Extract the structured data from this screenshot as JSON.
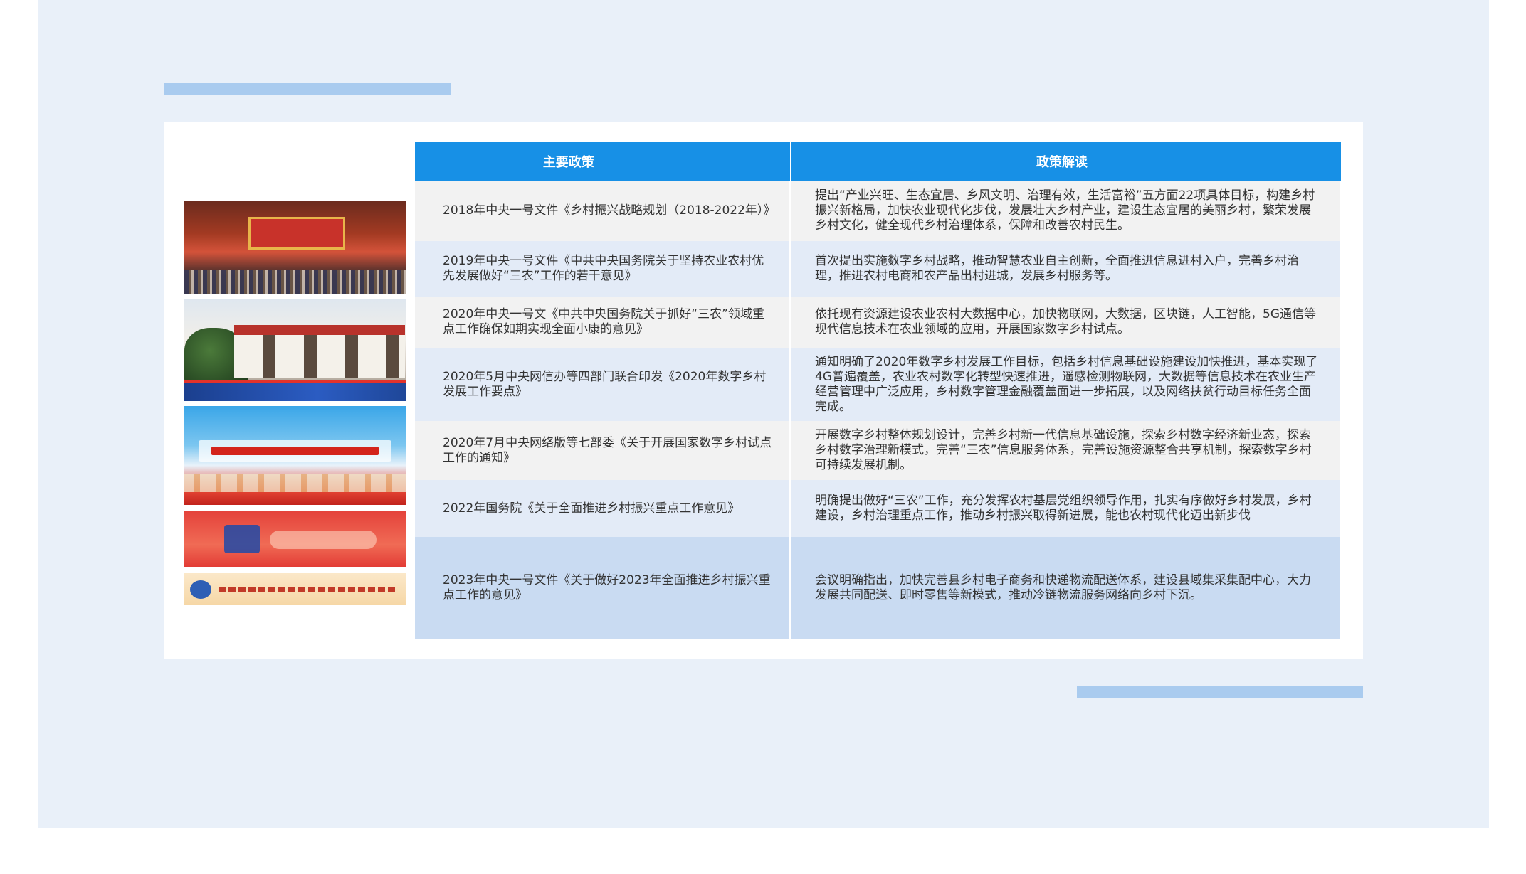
{
  "table": {
    "headers": [
      "主要政策",
      "政策解读"
    ],
    "rows": [
      {
        "policy": "2018年中央一号文件《乡村振兴战略规划（2018-2022年）》",
        "interpretation": "提出“产业兴旺、生态宜居、乡风文明、治理有效，生活富裕”五方面22项具体目标，构建乡村振兴新格局，加快农业现代化步伐，发展壮大乡村产业，建设生态宜居的美丽乡村，繁荣发展乡村文化，健全现代乡村治理体系，保障和改善农村民生。"
      },
      {
        "policy": "2019年中央一号文件《中共中央国务院关于坚持农业农村优先发展做好“三农”工作的若干意见》",
        "interpretation": "首次提出实施数字乡村战略，推动智慧农业自主创新，全面推进信息进村入户，完善乡村治理，推进农村电商和农产品出村进城，发展乡村服务等。"
      },
      {
        "policy": "2020年中央一号文《中共中央国务院关于抓好“三农”领域重点工作确保如期实现全面小康的意见》",
        "interpretation": "依托现有资源建设农业农村大数据中心，加快物联网，大数据，区块链，人工智能，5G通信等现代信息技术在农业领域的应用，开展国家数字乡村试点。"
      },
      {
        "policy": "2020年5月中央网信办等四部门联合印发《2020年数字乡村发展工作要点》",
        "interpretation": "通知明确了2020年数字乡村发展工作目标，包括乡村信息基础设施建设加快推进，基本实现了4G普遍覆盖，农业农村数字化转型快速推进，遥感检测物联网，大数据等信息技术在农业生产经营管理中广泛应用，乡村数字管理金融覆盖面进一步拓展，以及网络扶贫行动目标任务全面完成。"
      },
      {
        "policy": "2020年7月中央网络版等七部委《关于开展国家数字乡村试点工作的通知》",
        "interpretation": "开展数字乡村整体规划设计，完善乡村新一代信息基础设施，探索乡村数字经济新业态，探索乡村数字治理新模式，完善“三农”信息服务体系，完善设施资源整合共享机制，探索数字乡村可持续发展机制。"
      },
      {
        "policy": "2022年国务院《关于全面推进乡村振兴重点工作意见》",
        "interpretation": "明确提出做好“三农”工作，充分发挥农村基层党组织领导作用，扎实有序做好乡村发展，乡村建设，乡村治理重点工作，推动乡村振兴取得新进展，能也农村现代化迈出新步伐"
      },
      {
        "policy": "2023年中央一号文件《关于做好2023年全面推进乡村振兴重点工作的意见》",
        "interpretation": "会议明确指出，加快完善县乡村电子商务和快递物流配送体系，建设县域集采集配中心，大力发展共同配送、即时零售等新模式，推动冷链物流服务网络向乡村下沉。"
      }
    ]
  }
}
